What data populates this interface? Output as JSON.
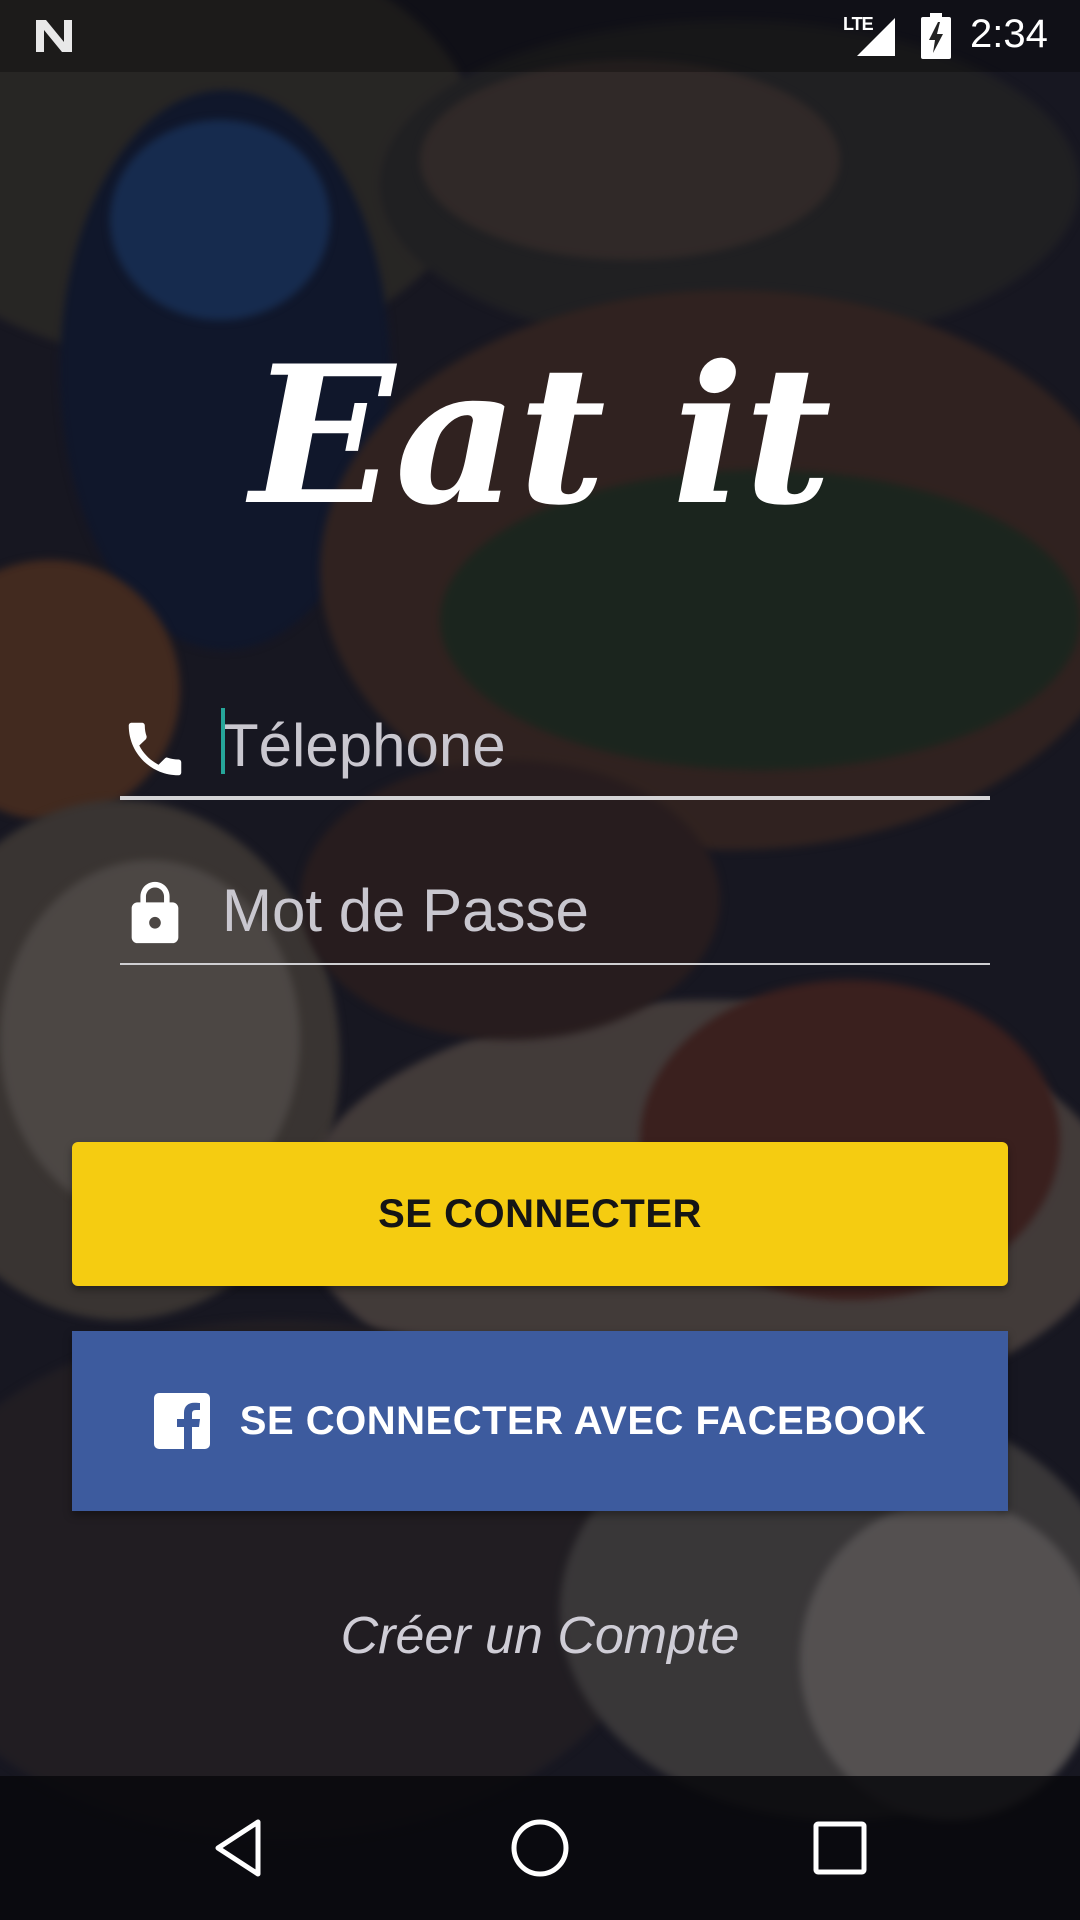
{
  "status_bar": {
    "network_label": "LTE",
    "time": "2:34"
  },
  "app": {
    "logo_text": "Eat it"
  },
  "form": {
    "phone": {
      "placeholder": "Télephone",
      "value": "",
      "icon": "phone-icon"
    },
    "password": {
      "placeholder": "Mot de Passe",
      "value": "",
      "icon": "lock-icon"
    }
  },
  "buttons": {
    "login_label": "SE CONNECTER",
    "facebook_label": "SE CONNECTER AVEC FACEBOOK",
    "facebook_icon": "facebook-icon"
  },
  "links": {
    "create_account": "Créer un Compte"
  },
  "nav_bar": {
    "items": [
      "back-icon",
      "home-icon",
      "recents-icon"
    ]
  },
  "colors": {
    "login_button": "#f5cc11",
    "facebook_button": "#3d5b9e",
    "caret": "#26a69a"
  }
}
